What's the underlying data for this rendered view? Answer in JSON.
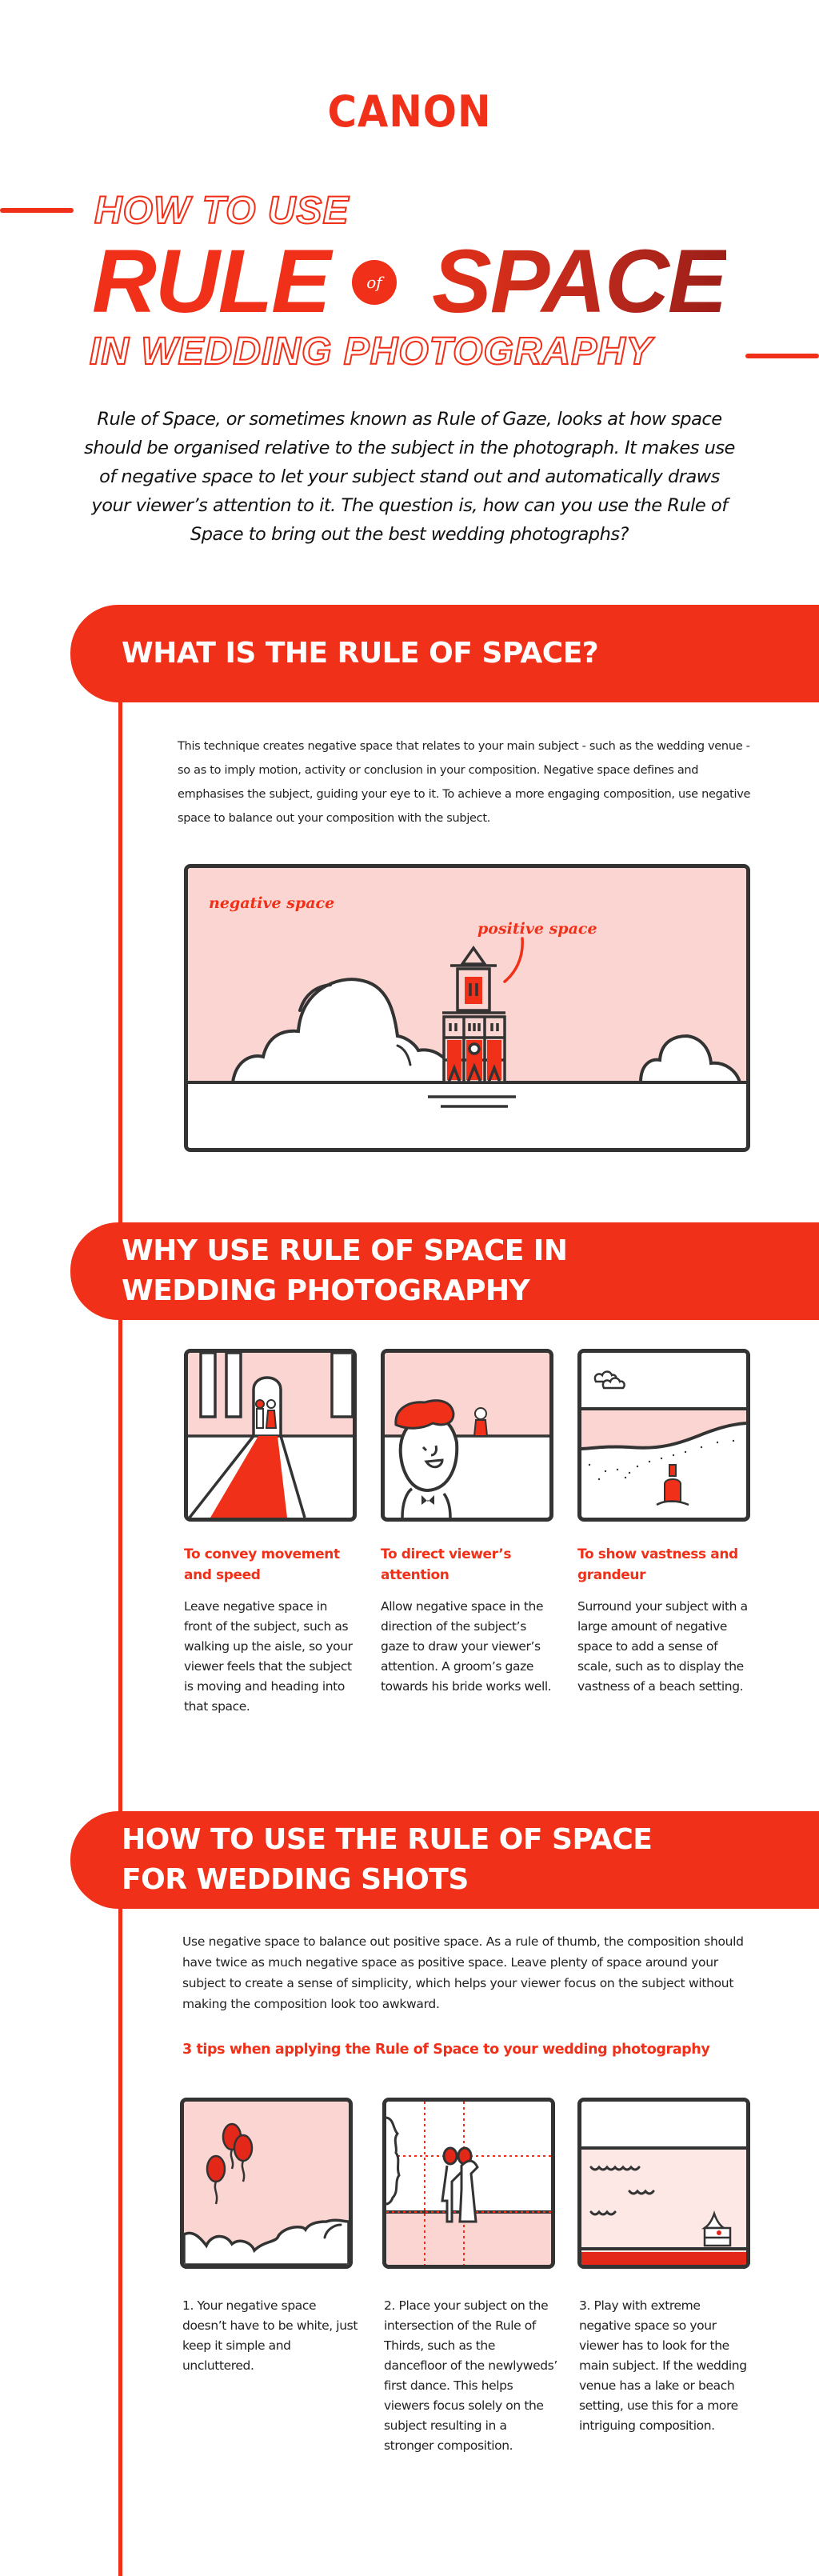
{
  "brand": {
    "logo": "CANON",
    "accent_color": "#f03018",
    "light_pink": "#fbd5d1",
    "dark_outline": "#333333"
  },
  "title": {
    "line1": "HOW TO USE",
    "main_left": "RULE",
    "of_badge": "of",
    "main_right": "SPACE",
    "line3": "IN WEDDING PHOTOGRAPHY"
  },
  "intro": "Rule of Space, or sometimes known as Rule of Gaze, looks at how space should be organised relative to the subject in the photograph. It makes use of negative space to let your subject stand out and automatically draws your viewer’s attention to it. The question is, how can you use the Rule of Space to bring out the best wedding photographs?",
  "sections": {
    "what": {
      "heading": "WHAT IS THE RULE OF SPACE?",
      "text": "This technique creates negative space that relates to your main subject - such as the wedding venue - so as to imply motion, activity or conclusion in your composition. Negative space defines and emphasises the subject, guiding your eye to it. To achieve a more engaging composition, use negative space to balance out your composition with the subject.",
      "illustration": {
        "label_negative": "negative space",
        "label_positive": "positive space"
      }
    },
    "why": {
      "heading_line1": "WHY USE RULE OF SPACE IN",
      "heading_line2": "WEDDING PHOTOGRAPHY",
      "reasons": [
        {
          "title": "To convey movement and speed",
          "text": "Leave negative space in front of the subject, such as walking up the aisle, so your viewer feels that the subject is moving and heading into that space."
        },
        {
          "title": "To direct viewer’s attention",
          "text": "Allow negative space in the direction of the subject’s gaze to draw your viewer’s attention. A groom’s gaze towards his bride works well."
        },
        {
          "title": "To show vastness and grandeur",
          "text": "Surround your subject with a large amount of negative space to add a sense of scale, such as to display the vastness of a beach setting."
        }
      ]
    },
    "how": {
      "heading_line1": "HOW TO USE THE RULE OF SPACE",
      "heading_line2": "FOR WEDDING SHOTS",
      "text": "Use negative space to balance out positive space. As a rule of thumb, the composition should have twice as much negative space as positive space. Leave plenty of space around your subject to create a sense of simplicity, which helps your viewer focus on the subject without making the composition look too awkward.",
      "tips_heading": "3 tips when applying the Rule of Space to your wedding photography",
      "tips": [
        "1. Your negative space doesn’t have to be white, just keep it simple and uncluttered.",
        "2.  Place your subject on the intersection of the Rule of Thirds, such as the dancefloor of the newlyweds’ first dance. This helps viewers focus solely on the subject resulting in a stronger composition.",
        "3.  Play with extreme negative space so your viewer has to look for the main subject. If the wedding venue has a lake or beach setting, use this for a more intriguing composition."
      ]
    }
  }
}
